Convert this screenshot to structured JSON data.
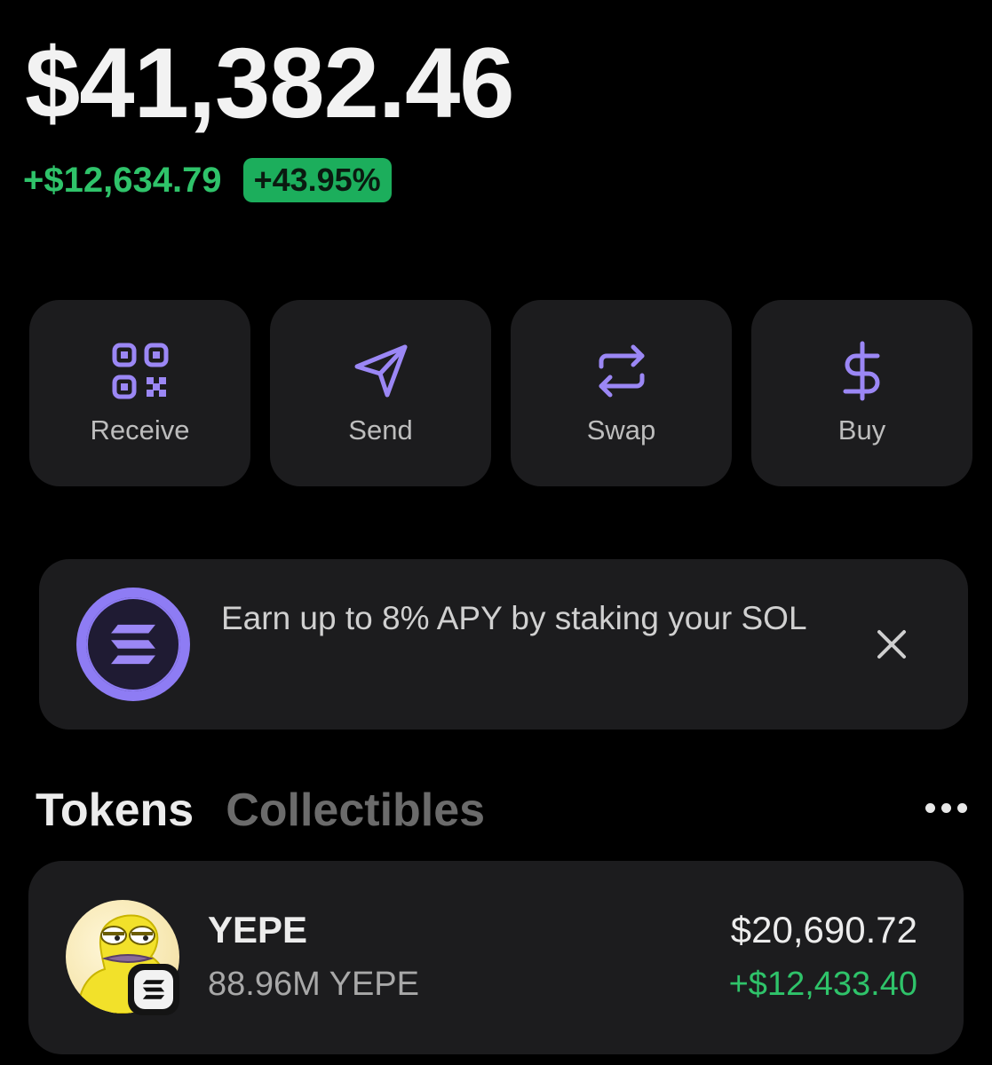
{
  "colors": {
    "positive": "#2fc36a",
    "positive_bg": "#1cae5c",
    "accent": "#8e7cf4",
    "card_bg": "#1c1c1e",
    "background": "#000000"
  },
  "balance": {
    "total": "$41,382.46",
    "change_amount": "+$12,634.79",
    "change_percent": "+43.95%"
  },
  "actions": [
    {
      "label": "Receive",
      "icon": "qr-code-icon"
    },
    {
      "label": "Send",
      "icon": "send-icon"
    },
    {
      "label": "Swap",
      "icon": "swap-icon"
    },
    {
      "label": "Buy",
      "icon": "dollar-icon"
    }
  ],
  "promo": {
    "icon": "solana-logo-icon",
    "text": "Earn up to 8% APY by staking your SOL",
    "close_icon": "close-icon"
  },
  "tabs": [
    {
      "label": "Tokens",
      "active": true
    },
    {
      "label": "Collectibles",
      "active": false
    }
  ],
  "more_icon": "more-horizontal-icon",
  "tokens": [
    {
      "name": "YEPE",
      "quantity": "88.96M YEPE",
      "value": "$20,690.72",
      "change": "+$12,433.40",
      "avatar": "yepe-frog-avatar",
      "chain_badge": "solana-badge-icon"
    }
  ]
}
